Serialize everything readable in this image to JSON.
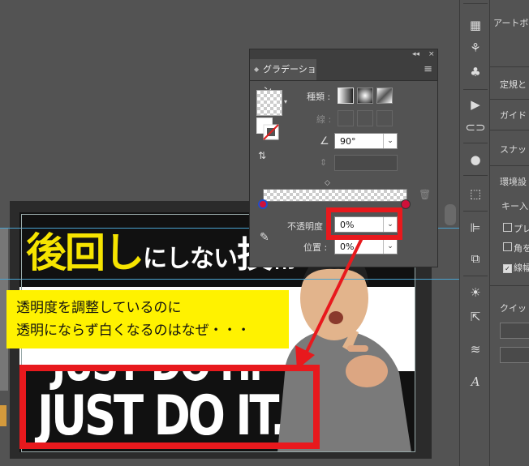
{
  "canvas": {
    "title_yellow": "後回し",
    "title_white": "にしない",
    "title_kanji": "技",
    "title_tail": "術",
    "ghost_text": "JUST DO IT.",
    "main_text": "JUST DO IT."
  },
  "callout": {
    "line1": "透明度を調整しているのに",
    "line2": "透明にならず白くなるのはなぜ・・・"
  },
  "gradient_panel": {
    "collapse_icon": "◂◂",
    "close_icon": "×",
    "tab_label": "グラデーション",
    "menu_icon": "≡",
    "type_label": "種類 :",
    "stroke_label": "線 :",
    "angle_value": "90°",
    "opacity_label": "不透明度 :",
    "opacity_value": "0%",
    "location_label": "位置 :",
    "location_value": "0%",
    "dropdown_icon": "⌄"
  },
  "right_panel": {
    "artboard_label": "アートボ",
    "item_teiki": "定規と",
    "item_guide": "ガイド",
    "item_snap": "スナッ",
    "item_env": "環境設",
    "item_key": "キー入",
    "chk1": "プレ",
    "chk2": "角を",
    "chk3": "線幅",
    "quick": "クイッ"
  },
  "colors": {
    "callout_bg": "#fff200",
    "highlight_red": "#e8191d",
    "title_yellow": "#f6e400",
    "stop_red": "#d0103a"
  }
}
